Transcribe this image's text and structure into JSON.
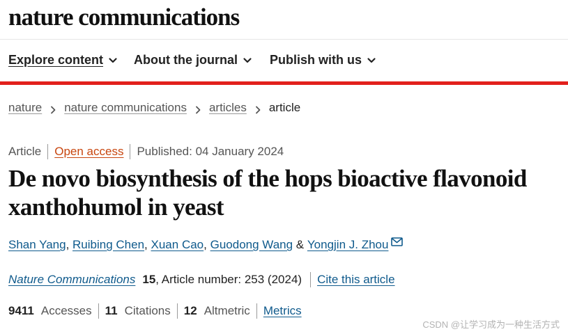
{
  "brand": {
    "name": "nature communications"
  },
  "nav": {
    "items": [
      {
        "label": "Explore content"
      },
      {
        "label": "About the journal"
      },
      {
        "label": "Publish with us"
      }
    ]
  },
  "accent_color": "#e2201c",
  "breadcrumb": {
    "items": [
      "nature",
      "nature communications",
      "articles"
    ],
    "current": "article"
  },
  "article": {
    "type": "Article",
    "access": "Open access",
    "published": "Published: 04 January 2024",
    "title": "De novo biosynthesis of the hops bioactive flavonoid xanthohumol in yeast",
    "authors": [
      {
        "name": "Shan Yang"
      },
      {
        "name": "Ruibing Chen"
      },
      {
        "name": "Xuan Cao"
      },
      {
        "name": "Guodong Wang"
      },
      {
        "name": "Yongjin J. Zhou"
      }
    ],
    "author_separator": ",",
    "author_conjunction": "&",
    "corresponding_icon": "mail-icon",
    "citation": {
      "journal": "Nature Communications",
      "volume": "15",
      "rest": ", Article number: 253 (2024)",
      "cite_label": "Cite this article"
    },
    "metrics": {
      "accesses_value": "9411",
      "accesses_label": "Accesses",
      "citations_value": "11",
      "citations_label": "Citations",
      "altmetric_value": "12",
      "altmetric_label": "Altmetric",
      "metrics_link": "Metrics"
    }
  },
  "watermark": "CSDN @让学习成为一种生活方式"
}
